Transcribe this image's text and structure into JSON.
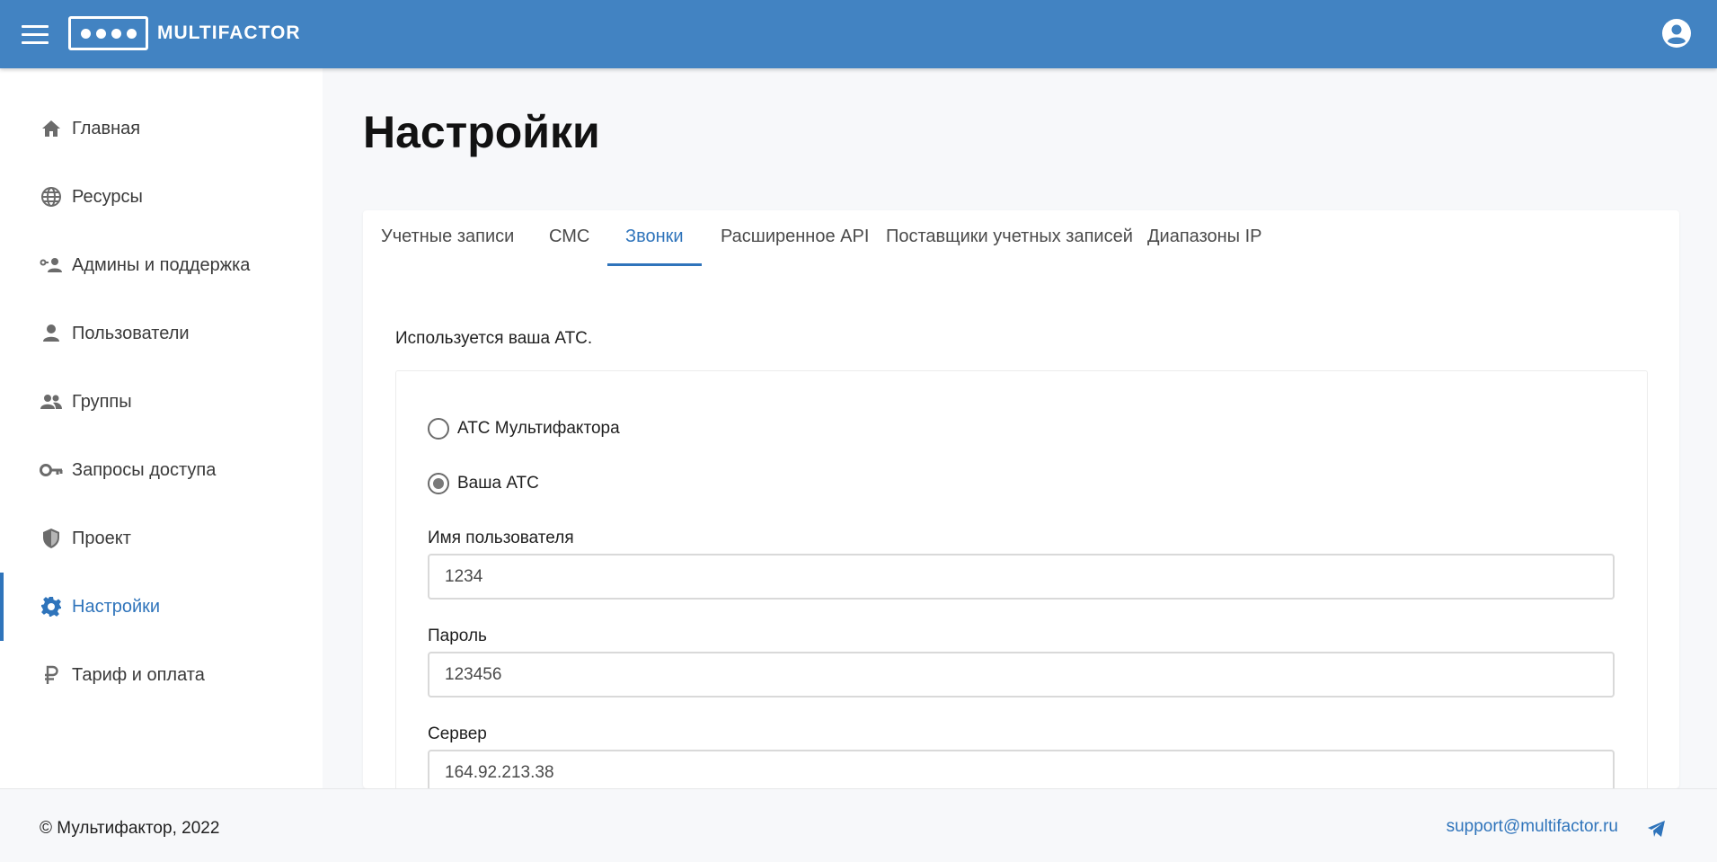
{
  "header": {
    "logo_text": "MULTIFACTOR",
    "brand_color": "#4283c2"
  },
  "sidebar": {
    "items": [
      {
        "label": "Главная",
        "icon": "home-icon"
      },
      {
        "label": "Ресурсы",
        "icon": "globe-icon"
      },
      {
        "label": "Админы и поддержка",
        "icon": "admin-support-icon"
      },
      {
        "label": "Пользователи",
        "icon": "user-icon"
      },
      {
        "label": "Группы",
        "icon": "group-icon"
      },
      {
        "label": "Запросы доступа",
        "icon": "key-icon"
      },
      {
        "label": "Проект",
        "icon": "shield-icon"
      },
      {
        "label": "Настройки",
        "icon": "gear-icon",
        "active": true
      },
      {
        "label": "Тариф и оплата",
        "icon": "ruble-icon"
      }
    ],
    "active_color": "#2f74bb"
  },
  "main": {
    "title": "Настройки",
    "tabs": [
      {
        "label": "Учетные записи"
      },
      {
        "label": "СМС"
      },
      {
        "label": "Звонки",
        "active": true
      },
      {
        "label": "Расширенное API"
      },
      {
        "label": "Поставщики учетных записей"
      },
      {
        "label": "Диапазоны IP"
      }
    ],
    "note": "Используется ваша АТС.",
    "radios": [
      {
        "label": "АТС Мультифактора",
        "checked": false
      },
      {
        "label": "Ваша АТС",
        "checked": true
      }
    ],
    "fields": {
      "username": {
        "label": "Имя пользователя",
        "value": "1234"
      },
      "password": {
        "label": "Пароль",
        "value": "123456"
      },
      "server": {
        "label": "Сервер",
        "value": "164.92.213.38"
      }
    }
  },
  "footer": {
    "copyright": "© Мультифактор, 2022",
    "support_email": "support@multifactor.ru",
    "telegram_icon": "telegram-icon"
  }
}
